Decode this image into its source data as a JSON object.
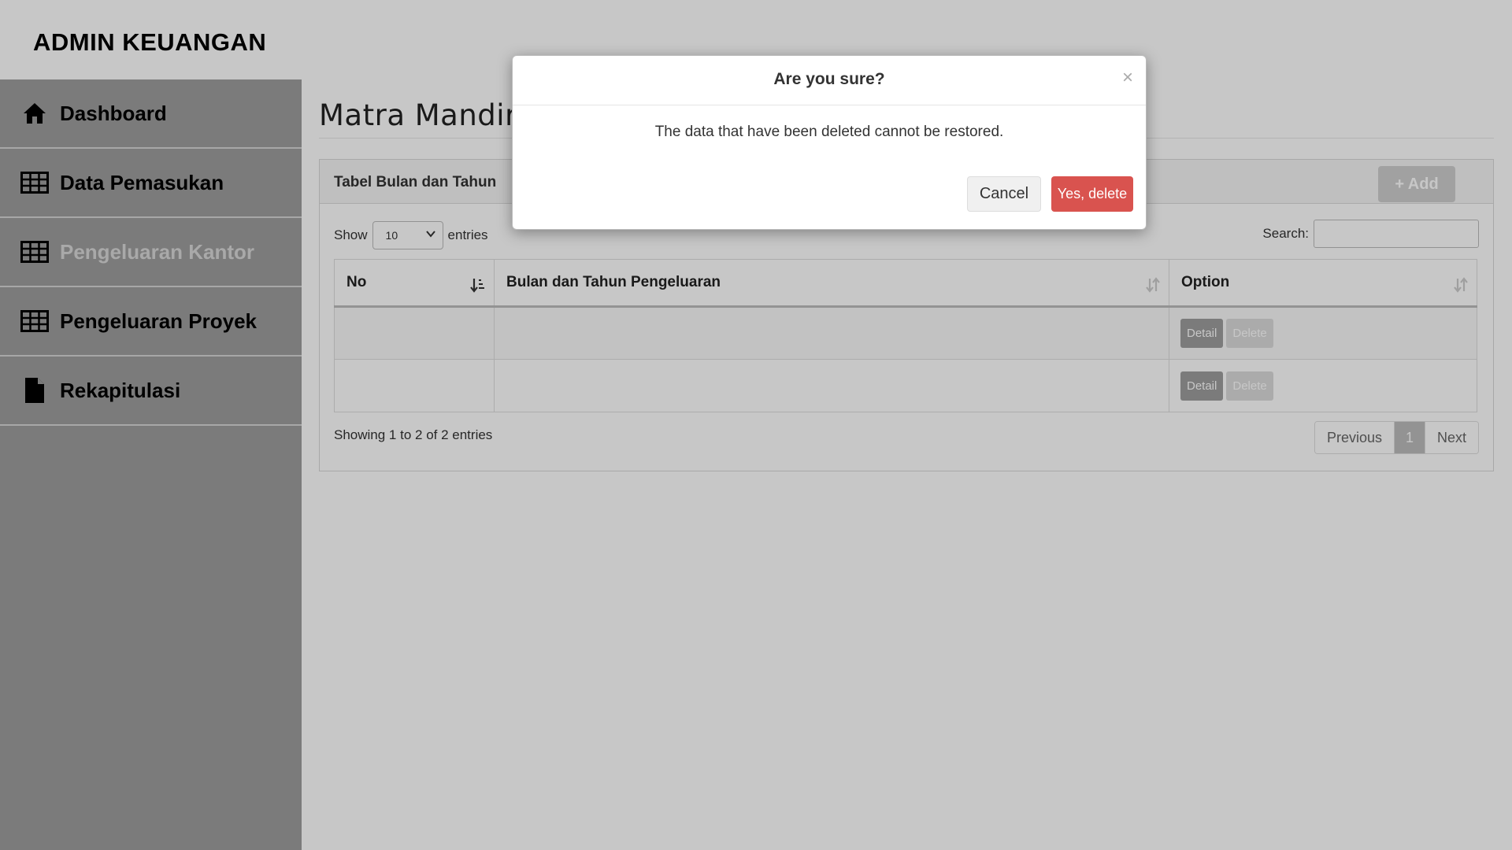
{
  "header": {
    "brand": "ADMIN KEUANGAN"
  },
  "sidebar": {
    "items": [
      {
        "label": "Dashboard",
        "icon": "home-icon",
        "active": false
      },
      {
        "label": "Data Pemasukan",
        "icon": "table-icon",
        "active": false
      },
      {
        "label": "Pengeluaran Kantor",
        "icon": "table-icon",
        "active": true
      },
      {
        "label": "Pengeluaran Proyek",
        "icon": "table-icon",
        "active": false
      },
      {
        "label": "Rekapitulasi",
        "icon": "file-icon",
        "active": false
      }
    ]
  },
  "main": {
    "page_title": "Matra Mandiri",
    "panel": {
      "title": "Tabel Bulan dan Tahun",
      "add_label": "+ Add",
      "show_label": "Show",
      "entries_value": "10",
      "entries_label": "entries",
      "search_label": "Search:",
      "search_value": "",
      "columns": [
        "No",
        "Bulan dan Tahun Pengeluaran",
        "Option"
      ],
      "rows": [
        {
          "no": "",
          "period": "",
          "detail_label": "Detail",
          "delete_label": "Delete"
        },
        {
          "no": "",
          "period": "",
          "detail_label": "Detail",
          "delete_label": "Delete"
        }
      ],
      "info": "Showing 1 to 2 of 2 entries",
      "pagination": {
        "previous": "Previous",
        "current": "1",
        "next": "Next"
      }
    }
  },
  "modal": {
    "title": "Are you sure?",
    "close": "×",
    "message": "The data that have been deleted cannot be restored.",
    "cancel_label": "Cancel",
    "confirm_label": "Yes, delete"
  },
  "colors": {
    "danger": "#d9534f",
    "sidebar_bg": "#9e9e9e",
    "detail_btn": "#9e9e9e",
    "delete_btn": "#dcdcdc"
  }
}
